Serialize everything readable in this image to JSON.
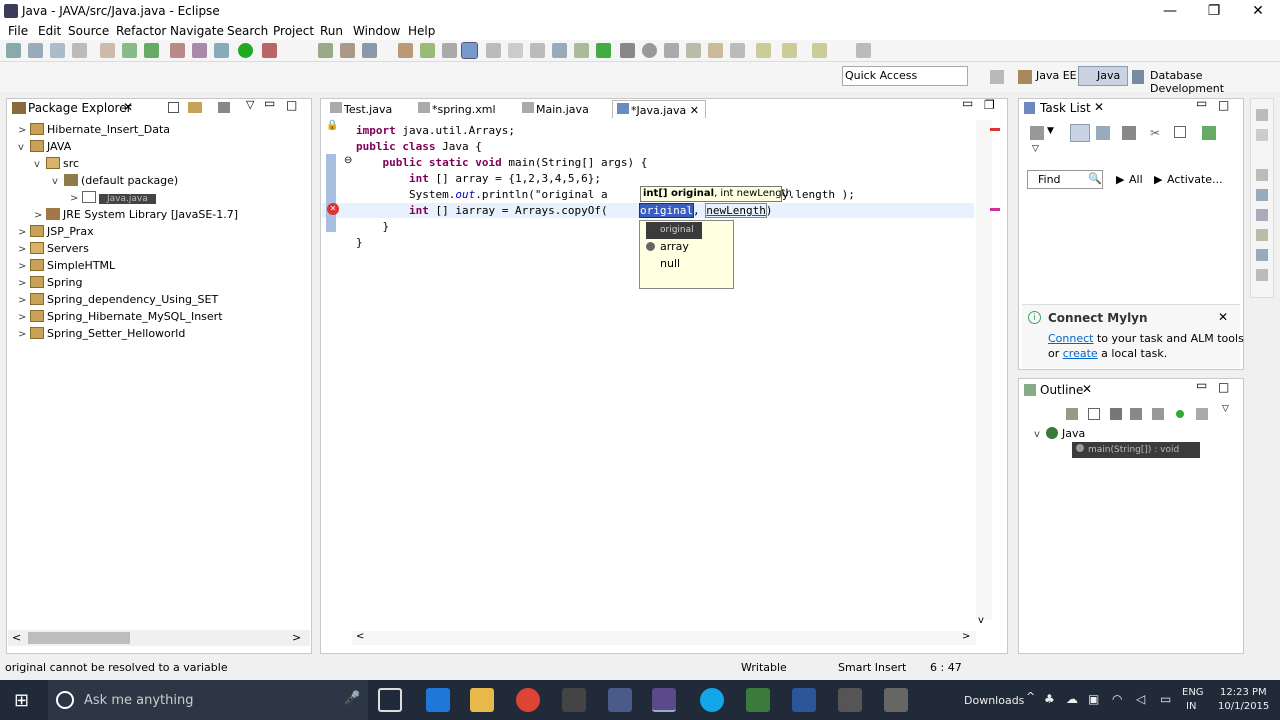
{
  "window": {
    "title": "Java - JAVA/src/Java.java - Eclipse",
    "min": "—",
    "max": "❐",
    "close": "✕"
  },
  "menu": [
    "File",
    "Edit",
    "Source",
    "Refactor",
    "Navigate",
    "Search",
    "Project",
    "Run",
    "Window",
    "Help"
  ],
  "quick_access": {
    "placeholder": "Quick Access"
  },
  "perspectives": {
    "java_ee": "Java EE",
    "java": "Java",
    "db": "Database Development"
  },
  "package_explorer": {
    "title": "Package Explorer",
    "items": [
      {
        "label": "Hibernate_Insert_Data"
      },
      {
        "label": "JAVA"
      },
      {
        "label": "src"
      },
      {
        "label": "(default package)"
      },
      {
        "label": "Java.java"
      },
      {
        "label": "JRE System Library",
        "suffix": "[JavaSE-1.7]"
      },
      {
        "label": "JSP_Prax"
      },
      {
        "label": "Servers"
      },
      {
        "label": "SimpleHTML"
      },
      {
        "label": "Spring"
      },
      {
        "label": "Spring_dependency_Using_SET"
      },
      {
        "label": "Spring_Hibernate_MySQL_Insert"
      },
      {
        "label": "Spring_Setter_Helloworld"
      }
    ]
  },
  "editor": {
    "tabs": [
      "Test.java",
      "*spring.xml",
      "Main.java",
      "*Java.java"
    ],
    "lines": [
      "import java.util.Arrays;",
      "public class Java {",
      "    public static void main(String[] args) {",
      "        int [] array = {1,2,3,4,5,6};",
      "        System.out.println(\"original a",
      "        int [] iarray = Arrays.copyOf(",
      "    }",
      "}"
    ],
    "line5_tail": "y.length );",
    "line6_args": [
      "original",
      ", ",
      "newLength",
      ")"
    ],
    "hint": {
      "bold": "int[] original",
      "rest": ", int newLength"
    },
    "proposals": [
      "original",
      "array",
      "null"
    ]
  },
  "task_list": {
    "title": "Task List",
    "find_placeholder": "Find",
    "all": "All",
    "activate": "Activate...",
    "mylyn": {
      "title": "Connect Mylyn",
      "connect": "Connect",
      "text1": " to your task and ALM tools",
      "or": "or ",
      "create": "create",
      "text2": " a local task."
    }
  },
  "outline": {
    "title": "Outline",
    "class": "Java",
    "method": "main(String[]) : void"
  },
  "status": {
    "message": "original cannot be resolved to a variable",
    "mode": "Writable",
    "insert": "Smart Insert",
    "position": "6 : 47"
  },
  "taskbar": {
    "search": "Ask me anything",
    "downloads": "Downloads",
    "lang1": "ENG",
    "lang2": "IN",
    "time": "12:23 PM",
    "date": "10/1/2015"
  },
  "colors": {
    "accent": "#0066cc",
    "keyword": "#7f0055",
    "taskbar": "#202a38"
  }
}
